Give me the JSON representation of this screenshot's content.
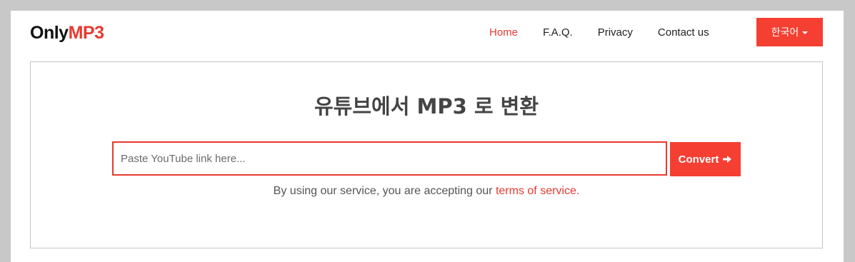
{
  "navbar": {
    "logo_prefix": "Only",
    "logo_suffix": "MP3",
    "links": [
      {
        "label": "Home",
        "active": true
      },
      {
        "label": "F.A.Q.",
        "active": false
      },
      {
        "label": "Privacy",
        "active": false
      },
      {
        "label": "Contact us",
        "active": false
      }
    ],
    "language_label": "한국어"
  },
  "main": {
    "title": "유튜브에서 MP3 로 변환",
    "input_placeholder": "Paste YouTube link here...",
    "input_value": "",
    "convert_label": "Convert",
    "terms_text": "By using our service, you are accepting our ",
    "terms_link": "terms of service."
  },
  "colors": {
    "accent": "#f43f32",
    "brand": "#e8392f",
    "background": "#c8c8c8"
  },
  "icons": {
    "convert": "arrow-right-icon",
    "language": "caret-down-icon"
  }
}
